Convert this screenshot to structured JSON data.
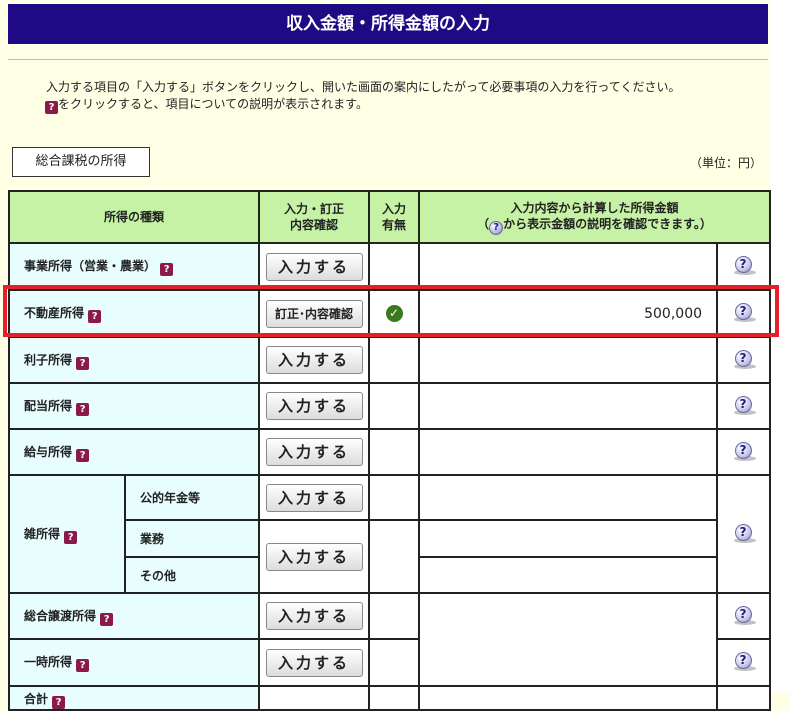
{
  "page": {
    "title": "収入金額・所得金額の入力"
  },
  "instructions": {
    "line1": "入力する項目の「入力する」ボタンをクリックし、開いた画面の案内にしたがって必要事項の入力を行ってください。",
    "line2": "をクリックすると、項目についての説明が表示されます。"
  },
  "tab": {
    "label": "総合課税の所得"
  },
  "unit_note": "（単位：円）",
  "table": {
    "headers": {
      "kind": "所得の種類",
      "entry_line1": "入力・訂正",
      "entry_line2": "内容確認",
      "status_line1": "入力",
      "status_line2": "有無",
      "amount_line1": "入力内容から計算した所得金額",
      "amount_line2_pre": "（",
      "amount_line2_post": "から表示金額の説明を確認できます。）"
    },
    "help_glyph": "?",
    "q_glyph": "?",
    "check_glyph": "✓",
    "rows": [
      {
        "label": "事業所得（営業・農業）",
        "button": "入力する",
        "has_input": false,
        "amount": ""
      },
      {
        "label": "不動産所得",
        "button": "訂正･内容確認",
        "has_input": true,
        "amount": "500,000"
      },
      {
        "label": "利子所得",
        "button": "入力する",
        "has_input": false,
        "amount": ""
      },
      {
        "label": "配当所得",
        "button": "入力する",
        "has_input": false,
        "amount": ""
      },
      {
        "label": "給与所得",
        "button": "入力する",
        "has_input": false,
        "amount": ""
      }
    ],
    "misc": {
      "label": "雑所得",
      "sub1": "公的年金等",
      "sub2": "業務",
      "sub3": "その他",
      "button1": "入力する",
      "button2": "入力する"
    },
    "rows2": [
      {
        "label": "総合譲渡所得",
        "button": "入力する"
      },
      {
        "label": "一時所得",
        "button": "入力する"
      }
    ],
    "partial_label": "合計"
  },
  "colors": {
    "banner": "#1e0a82",
    "header_bg": "#c6f2a6",
    "label_bg": "#e8fdfd",
    "highlight": "#e5202a",
    "page_bg": "#ffffe6"
  }
}
